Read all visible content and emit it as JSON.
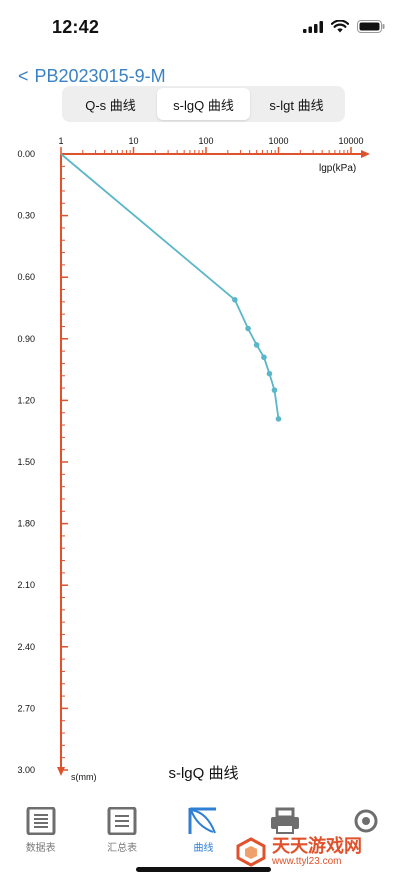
{
  "status": {
    "time": "12:42"
  },
  "nav": {
    "back_title": "PB2023015-9-M"
  },
  "segments": [
    {
      "label": "Q-s 曲线",
      "active": false
    },
    {
      "label": "s-lgQ 曲线",
      "active": true
    },
    {
      "label": "s-lgt 曲线",
      "active": false
    }
  ],
  "chart_data": {
    "type": "line",
    "title": "s-lgQ 曲线",
    "xlabel": "lgp(kPa)",
    "ylabel": "s(mm)",
    "x_scale": "log",
    "xlim": [
      1,
      10000
    ],
    "ylim": [
      0,
      3.0
    ],
    "x_ticks": [
      "1",
      "10",
      "100",
      "1000",
      "10000"
    ],
    "y_ticks": [
      "0.00",
      "0.30",
      "0.60",
      "0.90",
      "1.20",
      "1.50",
      "1.80",
      "2.10",
      "2.40",
      "2.70",
      "3.00"
    ],
    "series_color": "#5bb6c8",
    "axis_color": "#e0522c",
    "points": [
      {
        "x": 1,
        "y": 0.0,
        "marker": false
      },
      {
        "x": 250,
        "y": 0.71,
        "marker": true
      },
      {
        "x": 380,
        "y": 0.85,
        "marker": true
      },
      {
        "x": 500,
        "y": 0.93,
        "marker": true
      },
      {
        "x": 630,
        "y": 0.99,
        "marker": true
      },
      {
        "x": 750,
        "y": 1.07,
        "marker": true
      },
      {
        "x": 880,
        "y": 1.15,
        "marker": true
      },
      {
        "x": 1000,
        "y": 1.29,
        "marker": true
      }
    ]
  },
  "tabs": [
    {
      "label": "数据表",
      "icon": "data-table-icon",
      "active": false
    },
    {
      "label": "汇总表",
      "icon": "summary-table-icon",
      "active": false
    },
    {
      "label": "曲线",
      "icon": "curve-icon",
      "active": true
    },
    {
      "label": "",
      "icon": "printer-icon",
      "active": false
    },
    {
      "label": "",
      "icon": "settings-icon",
      "active": false
    }
  ],
  "watermark": {
    "title": "天天游戏网",
    "url": "www.ttyl23.com"
  }
}
